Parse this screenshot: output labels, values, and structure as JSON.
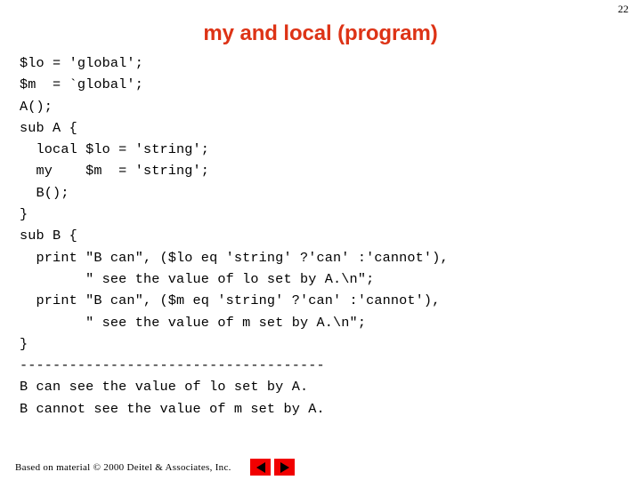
{
  "slide": {
    "number": "22",
    "title": "my and local (program)",
    "title_color": "#DD3316"
  },
  "code": {
    "lines": [
      "$lo = 'global';",
      "$m  = `global';",
      "A();",
      "sub A {",
      "  local $lo = 'string';",
      "  my    $m  = 'string';",
      "  B();",
      "}",
      "sub B {",
      "  print \"B can\", ($lo eq 'string' ?'can' :'cannot'),",
      "        \" see the value of lo set by A.\\n\";",
      "  print \"B can\", ($m eq 'string' ?'can' :'cannot'),",
      "        \" see the value of m set by A.\\n\";",
      "}",
      "-------------------------------------",
      "B can see the value of lo set by A.",
      "B cannot see the value of m set by A."
    ]
  },
  "footer": {
    "credit": "Based on material © 2000 Deitel & Associates, Inc.",
    "prev_label": "prev-slide",
    "next_label": "next-slide",
    "button_color": "#F10000"
  }
}
